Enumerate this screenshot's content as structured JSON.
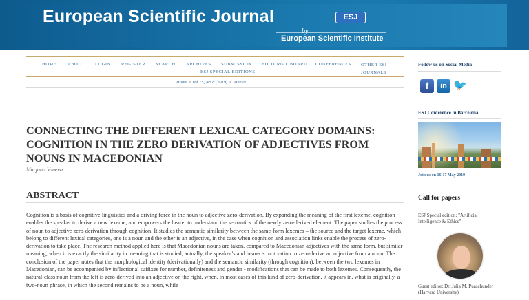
{
  "header": {
    "title": "European Scientific Journal",
    "logo_text": "ESJ",
    "by": "by",
    "institute": "European Scientific Institute"
  },
  "nav": {
    "items": [
      "HOME",
      "ABOUT",
      "LOGIN",
      "REGISTER",
      "SEARCH",
      "ARCHIVES",
      "SUBMISSION",
      "EDITORIAL BOARD",
      "CONFERENCES",
      "OTHER ESI JOURNALS",
      "ESJ SPECIAL EDITIONS"
    ]
  },
  "breadcrumb": {
    "home": "Home",
    "sep1": " > ",
    "issue": "Vol 15, No 8 (2019)",
    "sep2": " > ",
    "current": "Vaneva"
  },
  "article": {
    "title": "Connecting the Different Lexical Category Domains: Cognition in the Zero Derivation of Adjectives from Nouns in Macedonian",
    "author": "Marjana Vaneva",
    "abstract_heading": "ABSTRACT",
    "abstract_text": "Cognition is a basis of cognitive linguistics and a driving force in the noun to adjective zero-derivation. By expanding the meaning of the first lexeme, cognition enables the speaker to derive a new lexeme, and empowers the hearer to understand the semantics of the newly zero-derived element. The paper studies the process of noun to adjective zero-derivation through cognition. It studies the semantic similarity between the same-form lexemes – the source and the target lexeme, which belong to different lexical categories, one is a noun and the other is an adjective, in the case when cognition and association links enable the process of zero-derivation to take place. The research method applied here is that Macedonian nouns are taken, compared to Macedonian adjectives with the same form, but similar meaning, when it is exactly the similarity in meaning that is studied, actually, the speaker’s and hearer’s motivation to zero-derive an adjective from a noun. The conclusion of the paper notes that the morphological identity (derivationally) and the semantic similarity (through cognition), between the two lexemes in Macedonian, can be accompanied by inflectional suffixes for number, definiteness and gender - modifications that can be made to both lexemes. Consequently, the natural-class noun from the left is zero-derived into an adjective on the right, when, in most cases of this kind of zero-derivation, it appears in, what is originally, a two-noun phrase, in which the second remains to be a noun, while"
  },
  "sidebar": {
    "social_title": "Follow us on Social Media",
    "social_icons": [
      "facebook-icon",
      "linkedin-icon",
      "twitter-icon"
    ],
    "conference_title": "ESJ Conference in Barcelona",
    "conference_link": "Join us on 16-17 May 2019",
    "cfp_title": "Call for papers",
    "special_edition": "ESJ Special edition: \"Artificial Intelligence & Ethics\"",
    "guest_editor": "Guest editor: Dr. Julia M. Puaschunder (Harvard University)"
  },
  "colors": {
    "banner": "#1672a6",
    "nav_link": "#3a6d99",
    "rule": "#c9a868",
    "sidebar_title": "#1d3f66"
  }
}
